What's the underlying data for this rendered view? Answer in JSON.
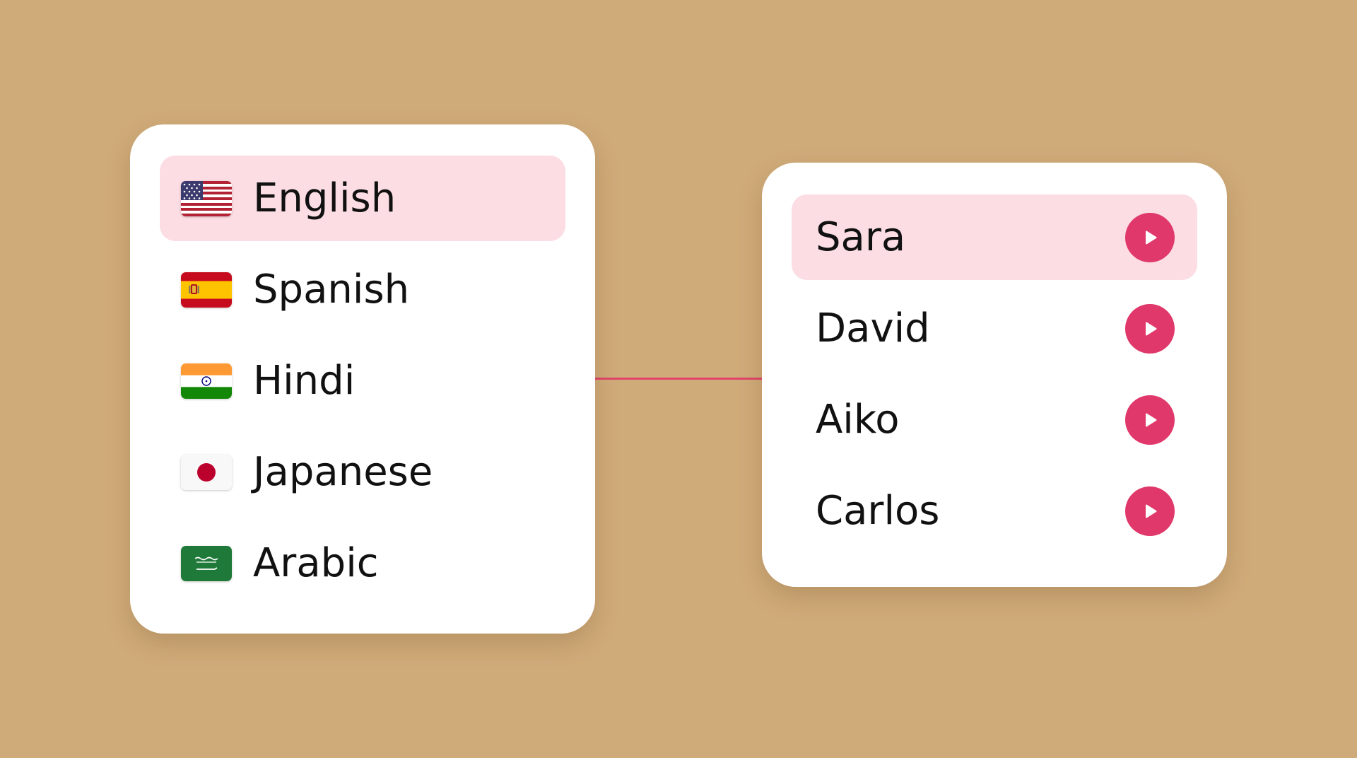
{
  "languages": {
    "selected_index": 0,
    "items": [
      {
        "label": "English",
        "icon": "us-flag-icon",
        "selected": true
      },
      {
        "label": "Spanish",
        "icon": "spain-flag-icon",
        "selected": false
      },
      {
        "label": "Hindi",
        "icon": "india-flag-icon",
        "selected": false
      },
      {
        "label": "Japanese",
        "icon": "japan-flag-icon",
        "selected": false
      },
      {
        "label": "Arabic",
        "icon": "saudi-arabia-flag-icon",
        "selected": false
      }
    ]
  },
  "voices": {
    "selected_index": 0,
    "items": [
      {
        "label": "Sara",
        "icon": "play-icon",
        "selected": true
      },
      {
        "label": "David",
        "icon": "play-icon",
        "selected": false
      },
      {
        "label": "Aiko",
        "icon": "play-icon",
        "selected": false
      },
      {
        "label": "Carlos",
        "icon": "play-icon",
        "selected": false
      }
    ]
  },
  "colors": {
    "background": "#d0ab7a",
    "card": "#ffffff",
    "selected_row": "#fcdde4",
    "accent": "#e0386a",
    "connector": "#e0446a",
    "text": "#111111"
  }
}
